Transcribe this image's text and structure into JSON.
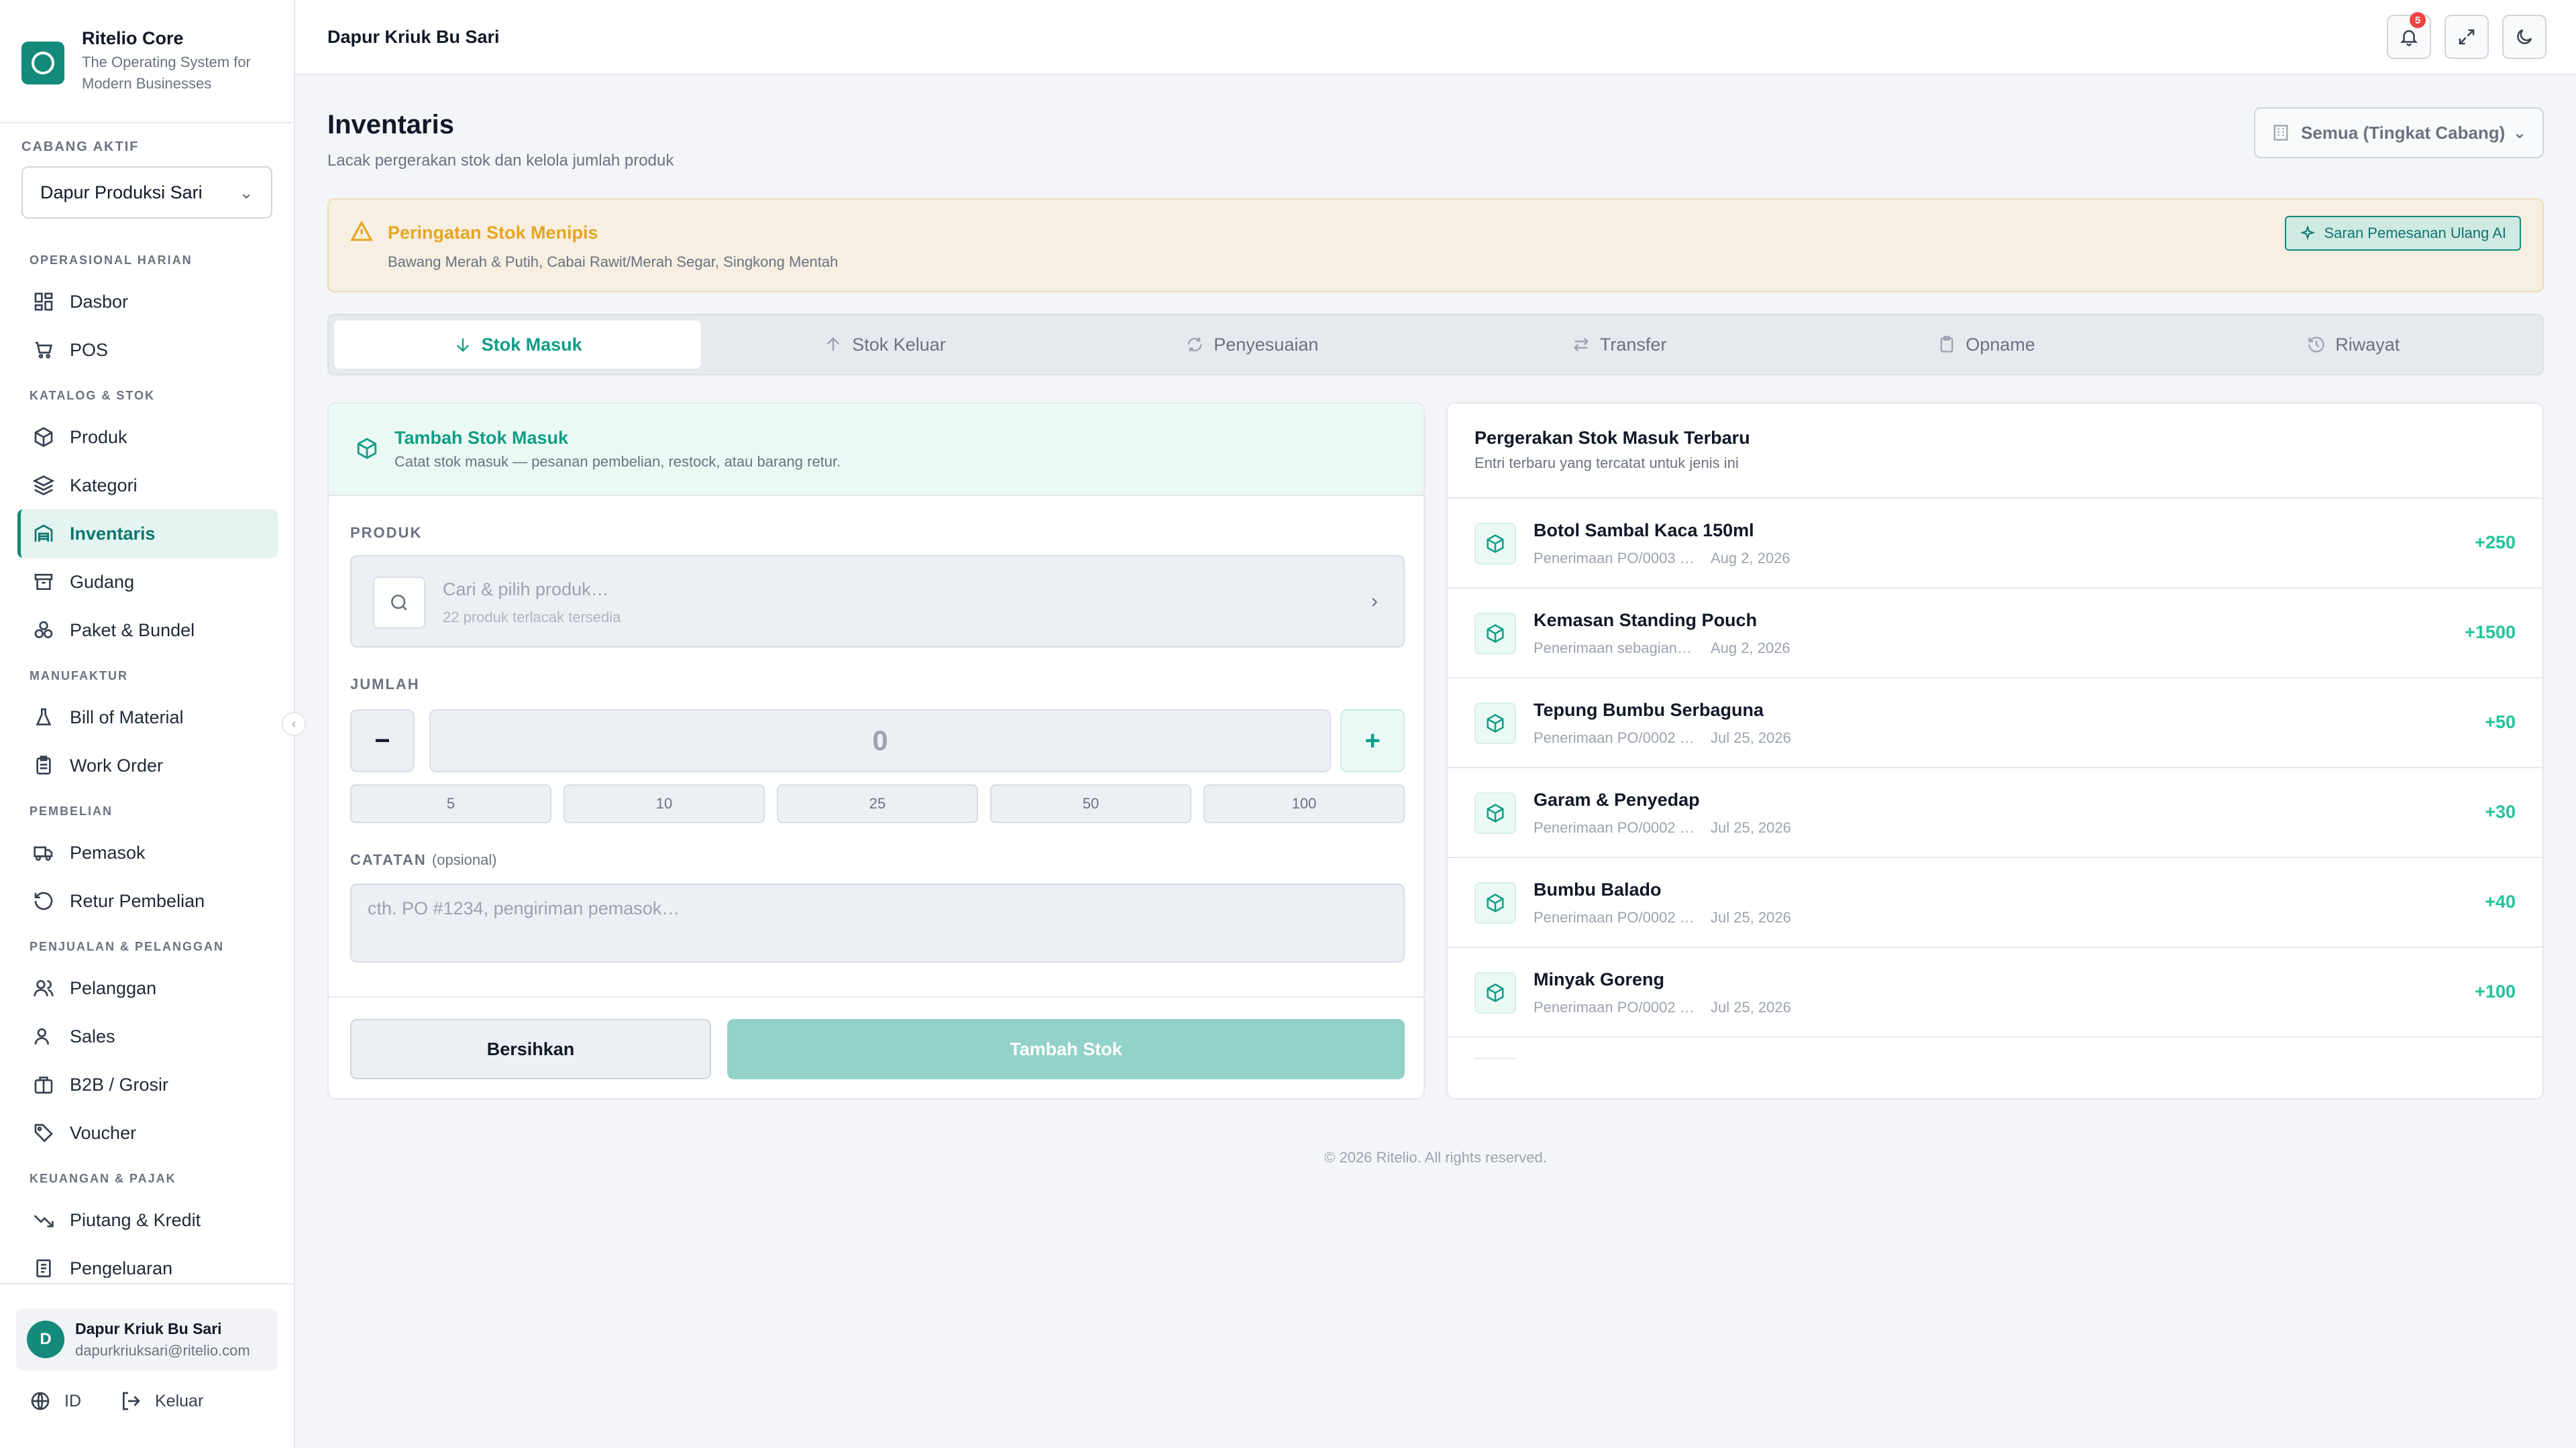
{
  "brand": {
    "name": "Ritelio Core",
    "tagline": "The Operating System for Modern Businesses"
  },
  "branch": {
    "label": "CABANG AKTIF",
    "selected": "Dapur Produksi Sari"
  },
  "nav": {
    "sections": [
      {
        "title": "OPERASIONAL HARIAN",
        "items": [
          {
            "label": "Dasbor",
            "icon": "dashboard-icon"
          },
          {
            "label": "POS",
            "icon": "cart-icon"
          }
        ]
      },
      {
        "title": "KATALOG & STOK",
        "items": [
          {
            "label": "Produk",
            "icon": "box-icon"
          },
          {
            "label": "Kategori",
            "icon": "layers-icon"
          },
          {
            "label": "Inventaris",
            "icon": "warehouse-icon",
            "active": true
          },
          {
            "label": "Gudang",
            "icon": "archive-icon"
          },
          {
            "label": "Paket & Bundel",
            "icon": "bundle-icon"
          }
        ]
      },
      {
        "title": "MANUFAKTUR",
        "items": [
          {
            "label": "Bill of Material",
            "icon": "flask-icon"
          },
          {
            "label": "Work Order",
            "icon": "clipboard-icon"
          }
        ]
      },
      {
        "title": "PEMBELIAN",
        "items": [
          {
            "label": "Pemasok",
            "icon": "truck-icon"
          },
          {
            "label": "Retur Pembelian",
            "icon": "rotate-icon"
          }
        ]
      },
      {
        "title": "PENJUALAN & PELANGGAN",
        "items": [
          {
            "label": "Pelanggan",
            "icon": "users-icon"
          },
          {
            "label": "Sales",
            "icon": "user-check-icon"
          },
          {
            "label": "B2B / Grosir",
            "icon": "building-icon"
          },
          {
            "label": "Voucher",
            "icon": "tag-icon"
          }
        ]
      },
      {
        "title": "KEUANGAN & PAJAK",
        "items": [
          {
            "label": "Piutang & Kredit",
            "icon": "trend-down-icon"
          },
          {
            "label": "Pengeluaran",
            "icon": "receipt-icon"
          }
        ]
      }
    ]
  },
  "user": {
    "initial": "D",
    "name": "Dapur Kriuk Bu Sari",
    "email": "dapurkriuksari@ritelio.com"
  },
  "footer": {
    "language": "ID",
    "logout": "Keluar"
  },
  "topbar": {
    "title": "Dapur Kriuk Bu Sari",
    "notification_count": "5"
  },
  "page": {
    "title": "Inventaris",
    "subtitle": "Lacak pergerakan stok dan kelola jumlah produk",
    "scope": "Semua (Tingkat Cabang)"
  },
  "alert": {
    "title": "Peringatan Stok Menipis",
    "body": "Bawang Merah & Putih, Cabai Rawit/Merah Segar, Singkong Mentah",
    "action": "Saran Pemesanan Ulang AI"
  },
  "tabs": [
    {
      "label": "Stok Masuk",
      "active": true
    },
    {
      "label": "Stok Keluar"
    },
    {
      "label": "Penyesuaian"
    },
    {
      "label": "Transfer"
    },
    {
      "label": "Opname"
    },
    {
      "label": "Riwayat"
    }
  ],
  "form": {
    "title": "Tambah Stok Masuk",
    "subtitle": "Catat stok masuk — pesanan pembelian, restock, atau barang retur.",
    "product_label": "PRODUK",
    "product_placeholder": "Cari & pilih produk…",
    "product_hint": "22 produk terlacak tersedia",
    "qty_label": "JUMLAH",
    "qty_value": "0",
    "presets": [
      "5",
      "10",
      "25",
      "50",
      "100"
    ],
    "notes_label": "CATATAN",
    "notes_optional": "(opsional)",
    "notes_placeholder": "cth. PO #1234, pengiriman pemasok…",
    "clear_label": "Bersihkan",
    "submit_label": "Tambah Stok"
  },
  "recent": {
    "title": "Pergerakan Stok Masuk Terbaru",
    "subtitle": "Entri terbaru yang tercatat untuk jenis ini",
    "items": [
      {
        "name": "Botol Sambal Kaca 150ml",
        "ref": "Penerimaan PO/0003 …",
        "date": "Aug 2, 2026",
        "qty": "+250"
      },
      {
        "name": "Kemasan Standing Pouch",
        "ref": "Penerimaan sebagian…",
        "date": "Aug 2, 2026",
        "qty": "+1500"
      },
      {
        "name": "Tepung Bumbu Serbaguna",
        "ref": "Penerimaan PO/0002 …",
        "date": "Jul 25, 2026",
        "qty": "+50"
      },
      {
        "name": "Garam & Penyedap",
        "ref": "Penerimaan PO/0002 …",
        "date": "Jul 25, 2026",
        "qty": "+30"
      },
      {
        "name": "Bumbu Balado",
        "ref": "Penerimaan PO/0002 …",
        "date": "Jul 25, 2026",
        "qty": "+40"
      },
      {
        "name": "Minyak Goreng",
        "ref": "Penerimaan PO/0002 …",
        "date": "Jul 25, 2026",
        "qty": "+100"
      }
    ]
  },
  "copyright": "© 2026 Ritelio. All rights reserved."
}
